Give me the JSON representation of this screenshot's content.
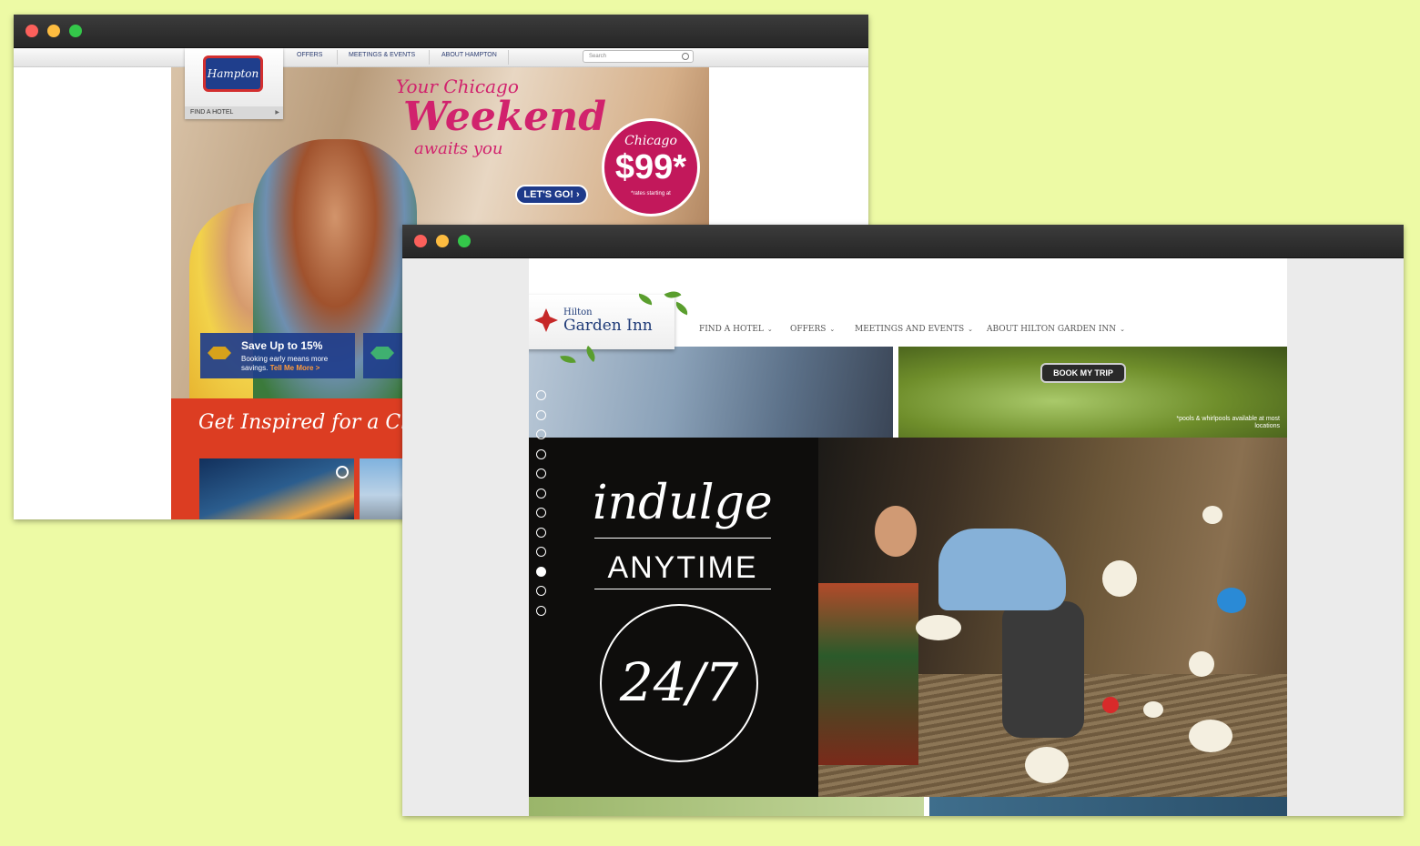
{
  "hampton": {
    "logo_text": "Hampton",
    "nav": [
      "OFFERS",
      "MEETINGS & EVENTS",
      "ABOUT HAMPTON"
    ],
    "search_placeholder": "Search",
    "find_hotel": "FIND A HOTEL",
    "headline_1": "Your Chicago",
    "headline_2": "Weekend",
    "headline_3": "awaits you",
    "cta": "LET'S GO!",
    "price_city": "Chicago",
    "price_value": "$99*",
    "price_note": "*rates starting at",
    "promo_title": "Save Up to 15%",
    "promo_body": "Booking early means more savings.",
    "promo_link": "Tell Me More >",
    "section_title": "Get Inspired for a Chicago"
  },
  "hgi": {
    "logo_hilton": "Hilton",
    "logo_name": "Garden Inn",
    "nav": [
      "FIND A HOTEL",
      "OFFERS",
      "MEETINGS AND EVENTS",
      "ABOUT HILTON GARDEN INN"
    ],
    "book_button": "BOOK MY TRIP",
    "pools_note": "*pools & whirlpools available at most locations",
    "hero_line_1": "indulge",
    "hero_line_2": "ANYTIME",
    "hero_line_3": "24/7",
    "slide_count": 12,
    "active_slide": 10
  },
  "colors": {
    "background": "#edfaa5",
    "hampton_navy": "#1f3e8c",
    "hampton_pink": "#d1226d",
    "hampton_red": "#dc3d22",
    "hgi_navy": "#1f3b78"
  }
}
